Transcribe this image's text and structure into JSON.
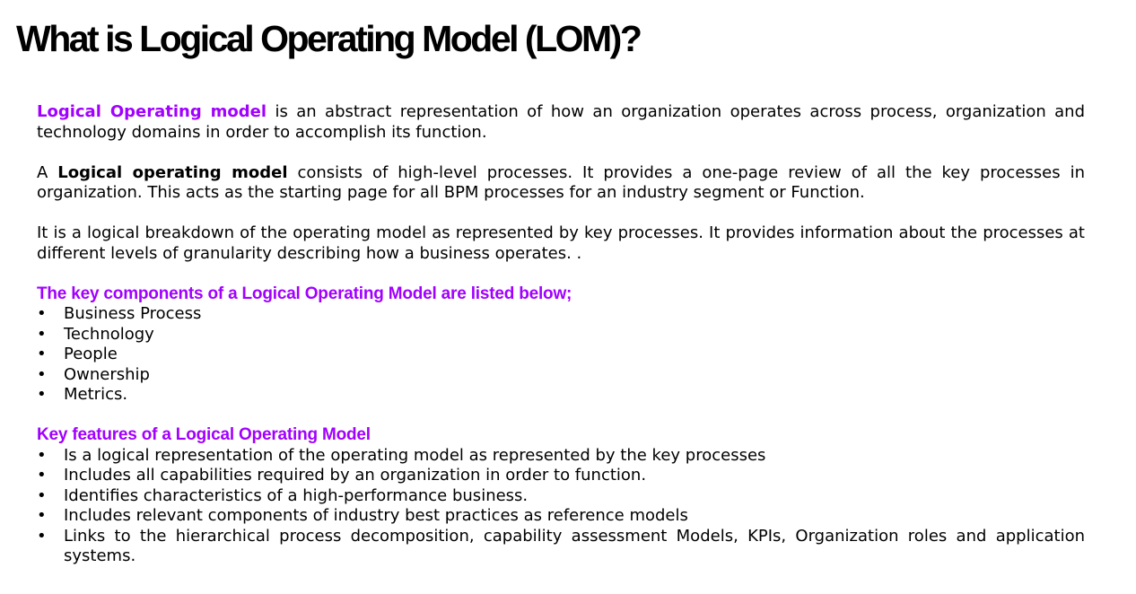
{
  "title": "What is Logical Operating Model (LOM)?",
  "para1": {
    "highlight": "Logical Operating model",
    "text": " is an abstract representation of how an organization operates across process, organization and technology domains in order to accomplish its function."
  },
  "para2": {
    "prefix": "A ",
    "bold": "Logical operating model",
    "text": " consists of high-level processes. It provides a one-page review of all the key processes in organization. This acts as the starting page for all BPM processes for an industry segment or Function."
  },
  "para3": {
    "text": "It is a logical breakdown of the operating model as represented by key processes. It provides information about the processes at different levels of granularity describing how a business operates. ."
  },
  "components": {
    "heading": "The key components of a Logical Operating Model are listed below;",
    "items": [
      "Business Process",
      "Technology",
      "People",
      "Ownership",
      "Metrics."
    ]
  },
  "features": {
    "heading": "Key features of a Logical Operating Model",
    "items": [
      "Is a logical representation of the operating model as represented by the key processes",
      "Includes all capabilities required by an organization in order to function.",
      "Identifies characteristics of a high-performance business.",
      "Includes relevant components of industry best practices as reference models",
      "Links to the hierarchical process decomposition, capability assessment Models, KPIs, Organization roles and application systems."
    ]
  },
  "bullet_char": "•",
  "colors": {
    "accent": "#a100ff",
    "text": "#000000",
    "background": "#ffffff"
  }
}
